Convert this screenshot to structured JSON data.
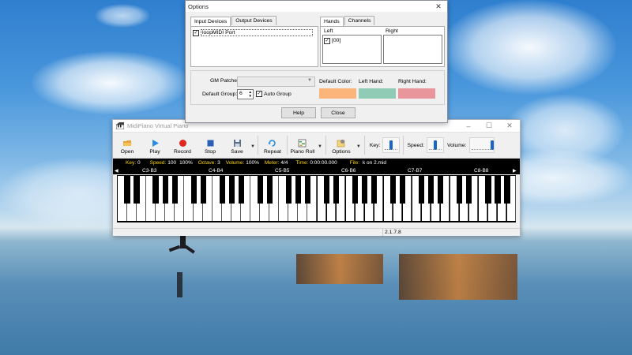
{
  "main_window": {
    "title": "MidiPiano Virtual Piano",
    "toolbar": {
      "open": "Open",
      "play": "Play",
      "record": "Record",
      "stop": "Stop",
      "save": "Save",
      "repeat": "Repeat",
      "piano_roll": "Piano Roll",
      "options": "Options",
      "key_label": "Key:",
      "speed_label": "Speed:",
      "volume_label": "Volume:",
      "key_level": 0.5,
      "speed_level": 0.5,
      "volume_level": 1.0
    },
    "info": {
      "key_label": "Key:",
      "key_value": "0",
      "speed_label": "Speed:",
      "speed_value": "100",
      "speed_pct": "100%",
      "octave_label": "Octave:",
      "octave_value": "3",
      "volume_label": "Volume:",
      "volume_value": "100%",
      "meter_label": "Meter:",
      "meter_value": "4/4",
      "time_label": "Time:",
      "time_value": "0:00:00.000",
      "file_label": "File:",
      "file_value": "k on 2.mid"
    },
    "octaves": [
      "C3-B3",
      "C4-B4",
      "C5-B5",
      "C6-B6",
      "C7-B7",
      "C8-B8"
    ],
    "version": "2.1.7.8"
  },
  "options_dialog": {
    "title": "Options",
    "tabs_left": [
      "Input Devices",
      "Output Devices"
    ],
    "tabs_right": [
      "Hands",
      "Channels"
    ],
    "input_devices": [
      {
        "label": "loopMIDI Port",
        "checked": true
      }
    ],
    "left_label": "Left",
    "right_label": "Right",
    "left_items": [
      {
        "label": "[00]",
        "checked": true
      }
    ],
    "gm_patches_label": "GM Patches:",
    "default_group_label": "Default Group:",
    "default_group_value": "6",
    "auto_group_label": "Auto Group",
    "auto_group_checked": true,
    "default_color_label": "Default Color:",
    "left_hand_label": "Left Hand:",
    "right_hand_label": "Right Hand:",
    "colors": {
      "default": "#fbb57a",
      "left": "#8fcbb5",
      "right": "#e8969c"
    },
    "help": "Help",
    "close": "Close"
  },
  "colors": {
    "accent": "#1a63c8",
    "info_text": "#ffd800"
  }
}
